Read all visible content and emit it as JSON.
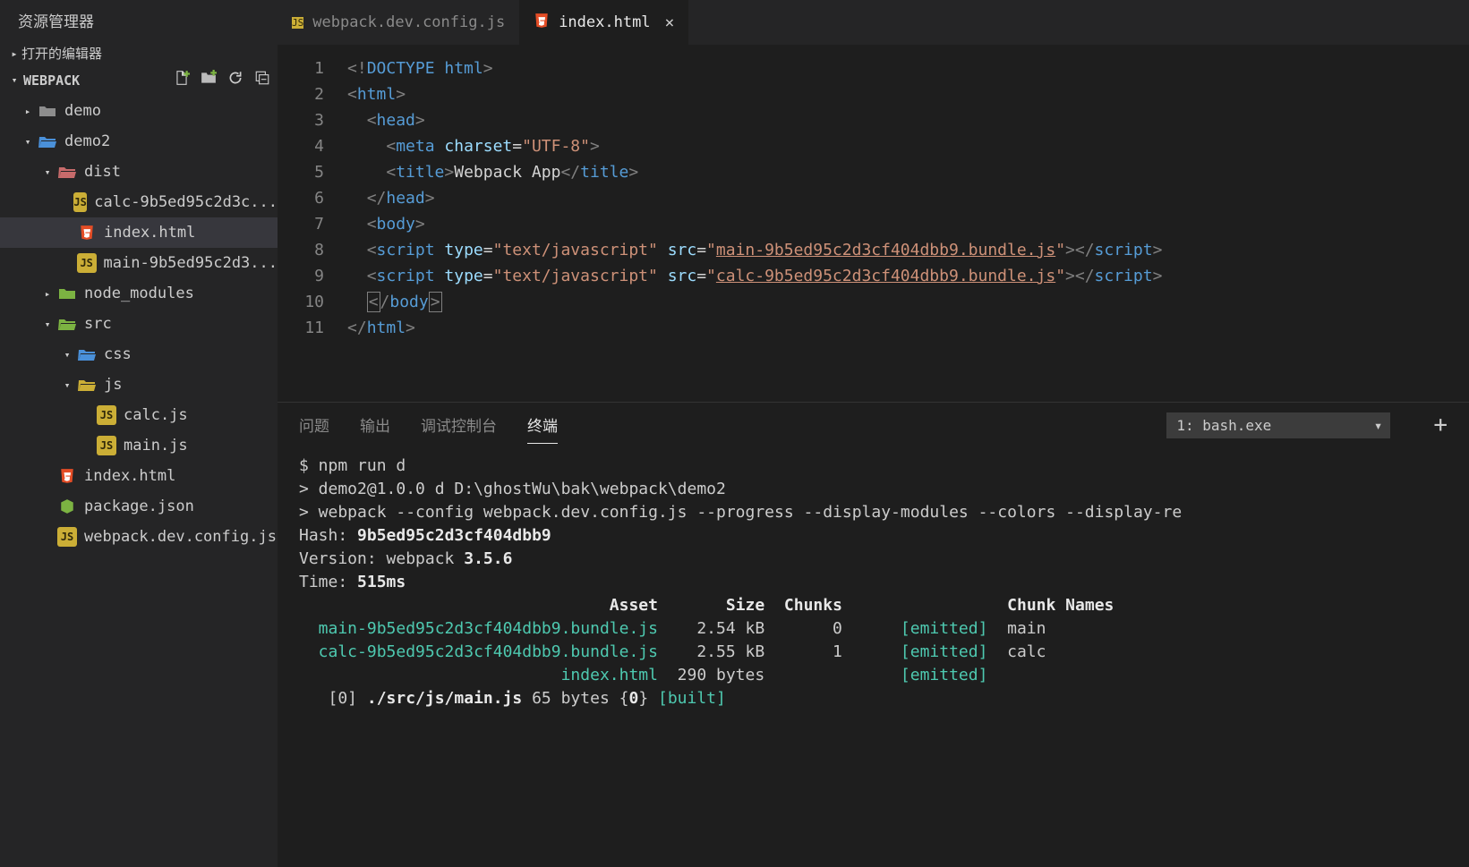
{
  "sidebar": {
    "title": "资源管理器",
    "sections": {
      "openEditors": "打开的编辑器",
      "workspace": "WEBPACK"
    },
    "tree": [
      {
        "depth": 0,
        "chev": "▸",
        "iconType": "folder",
        "iconClass": "ic-folder-g",
        "label": "demo"
      },
      {
        "depth": 0,
        "chev": "▾",
        "iconType": "folder",
        "iconClass": "ic-folder-o",
        "label": "demo2"
      },
      {
        "depth": 1,
        "chev": "▾",
        "iconType": "folder",
        "iconClass": "ic-folder-r",
        "label": "dist"
      },
      {
        "depth": 2,
        "chev": "",
        "iconType": "js",
        "label": "calc-9b5ed95c2d3c..."
      },
      {
        "depth": 2,
        "chev": "",
        "iconType": "html",
        "label": "index.html",
        "active": true
      },
      {
        "depth": 2,
        "chev": "",
        "iconType": "js",
        "label": "main-9b5ed95c2d3..."
      },
      {
        "depth": 1,
        "chev": "▸",
        "iconType": "folder",
        "iconClass": "ic-folder-gr",
        "label": "node_modules"
      },
      {
        "depth": 1,
        "chev": "▾",
        "iconType": "folder",
        "iconClass": "ic-folder-gr",
        "label": "src"
      },
      {
        "depth": 2,
        "chev": "▾",
        "iconType": "folder",
        "iconClass": "ic-folder-o",
        "label": "css"
      },
      {
        "depth": 2,
        "chev": "▾",
        "iconType": "folder",
        "iconClass": "ic-folder-y",
        "label": "js"
      },
      {
        "depth": 3,
        "chev": "",
        "iconType": "js",
        "label": "calc.js"
      },
      {
        "depth": 3,
        "chev": "",
        "iconType": "js",
        "label": "main.js"
      },
      {
        "depth": 1,
        "chev": "",
        "iconType": "html",
        "label": "index.html"
      },
      {
        "depth": 1,
        "chev": "",
        "iconType": "json",
        "label": "package.json"
      },
      {
        "depth": 1,
        "chev": "",
        "iconType": "js",
        "label": "webpack.dev.config.js"
      }
    ]
  },
  "tabs": [
    {
      "iconType": "js",
      "label": "webpack.dev.config.js",
      "active": false
    },
    {
      "iconType": "html",
      "label": "index.html",
      "active": true,
      "closable": true
    }
  ],
  "code": {
    "lines": [
      "1",
      "2",
      "3",
      "4",
      "5",
      "6",
      "7",
      "8",
      "9",
      "10",
      "11"
    ],
    "tokens": [
      [
        {
          "c": "t-bracket",
          "t": "<!"
        },
        {
          "c": "t-doctype",
          "t": "DOCTYPE html"
        },
        {
          "c": "t-bracket",
          "t": ">"
        }
      ],
      [
        {
          "c": "t-bracket",
          "t": "<"
        },
        {
          "c": "t-tag",
          "t": "html"
        },
        {
          "c": "t-bracket",
          "t": ">"
        }
      ],
      [
        {
          "sp": 2
        },
        {
          "c": "t-bracket",
          "t": "<"
        },
        {
          "c": "t-tag",
          "t": "head"
        },
        {
          "c": "t-bracket",
          "t": ">"
        }
      ],
      [
        {
          "sp": 4
        },
        {
          "c": "t-bracket",
          "t": "<"
        },
        {
          "c": "t-tag",
          "t": "meta"
        },
        {
          "t": " "
        },
        {
          "c": "t-attr",
          "t": "charset"
        },
        {
          "c": "t-eq",
          "t": "="
        },
        {
          "c": "t-str",
          "t": "\"UTF-8\""
        },
        {
          "c": "t-bracket",
          "t": ">"
        }
      ],
      [
        {
          "sp": 4
        },
        {
          "c": "t-bracket",
          "t": "<"
        },
        {
          "c": "t-tag",
          "t": "title"
        },
        {
          "c": "t-bracket",
          "t": ">"
        },
        {
          "c": "t-txt",
          "t": "Webpack App"
        },
        {
          "c": "t-bracket",
          "t": "</"
        },
        {
          "c": "t-tag",
          "t": "title"
        },
        {
          "c": "t-bracket",
          "t": ">"
        }
      ],
      [
        {
          "sp": 2
        },
        {
          "c": "t-bracket",
          "t": "</"
        },
        {
          "c": "t-tag",
          "t": "head"
        },
        {
          "c": "t-bracket",
          "t": ">"
        }
      ],
      [
        {
          "sp": 2
        },
        {
          "c": "t-bracket",
          "t": "<"
        },
        {
          "c": "t-tag",
          "t": "body"
        },
        {
          "c": "t-bracket",
          "t": ">"
        }
      ],
      [
        {
          "sp": 2
        },
        {
          "c": "t-bracket",
          "t": "<"
        },
        {
          "c": "t-tag",
          "t": "script"
        },
        {
          "t": " "
        },
        {
          "c": "t-attr",
          "t": "type"
        },
        {
          "c": "t-eq",
          "t": "="
        },
        {
          "c": "t-str",
          "t": "\"text/javascript\""
        },
        {
          "t": " "
        },
        {
          "c": "t-attr",
          "t": "src"
        },
        {
          "c": "t-eq",
          "t": "="
        },
        {
          "c": "t-str",
          "t": "\""
        },
        {
          "c": "t-link",
          "t": "main-9b5ed95c2d3cf404dbb9.bundle.js"
        },
        {
          "c": "t-str",
          "t": "\""
        },
        {
          "c": "t-bracket",
          "t": "></"
        },
        {
          "c": "t-tag",
          "t": "script"
        },
        {
          "c": "t-bracket",
          "t": ">"
        }
      ],
      [
        {
          "sp": 2
        },
        {
          "c": "t-bracket",
          "t": "<"
        },
        {
          "c": "t-tag",
          "t": "script"
        },
        {
          "t": " "
        },
        {
          "c": "t-attr",
          "t": "type"
        },
        {
          "c": "t-eq",
          "t": "="
        },
        {
          "c": "t-str",
          "t": "\"text/javascript\""
        },
        {
          "t": " "
        },
        {
          "c": "t-attr",
          "t": "src"
        },
        {
          "c": "t-eq",
          "t": "="
        },
        {
          "c": "t-str",
          "t": "\""
        },
        {
          "c": "t-link",
          "t": "calc-9b5ed95c2d3cf404dbb9.bundle.js"
        },
        {
          "c": "t-str",
          "t": "\""
        },
        {
          "c": "t-bracket",
          "t": "></"
        },
        {
          "c": "t-tag",
          "t": "script"
        },
        {
          "c": "t-bracket",
          "t": ">"
        }
      ],
      [
        {
          "sp": 2
        },
        {
          "box": true,
          "c": "t-bracket",
          "t": "<"
        },
        {
          "c": "t-bracket",
          "t": "/"
        },
        {
          "c": "t-tag",
          "t": "body"
        },
        {
          "box": true,
          "c": "t-bracket",
          "t": ">"
        }
      ],
      [
        {
          "c": "t-bracket",
          "t": "</"
        },
        {
          "c": "t-tag",
          "t": "html"
        },
        {
          "c": "t-bracket",
          "t": ">"
        }
      ]
    ]
  },
  "panel": {
    "tabs": [
      "问题",
      "输出",
      "调试控制台",
      "终端"
    ],
    "activeTab": 3,
    "select": "1: bash.exe",
    "terminal": [
      {
        "t": "$ npm run d"
      },
      {
        "t": ""
      },
      {
        "t": "> demo2@1.0.0 d D:\\ghostWu\\bak\\webpack\\demo2"
      },
      {
        "t": "> webpack --config webpack.dev.config.js --progress --display-modules --colors --display-re"
      },
      {
        "t": ""
      },
      {
        "segs": [
          {
            "t": "Hash: "
          },
          {
            "c": "tm-bold",
            "t": "9b5ed95c2d3cf404dbb9"
          }
        ]
      },
      {
        "segs": [
          {
            "t": "Version: webpack "
          },
          {
            "c": "tm-bold",
            "t": "3.5.6"
          }
        ]
      },
      {
        "segs": [
          {
            "t": "Time: "
          },
          {
            "c": "tm-bold",
            "t": "515ms"
          }
        ]
      },
      {
        "cols": [
          "Asset",
          "Size",
          "Chunks",
          "",
          "Chunk Names"
        ],
        "head": true
      },
      {
        "cols": [
          "main-9b5ed95c2d3cf404dbb9.bundle.js",
          "2.54 kB",
          "0",
          "[emitted]",
          "main"
        ],
        "asset": true
      },
      {
        "cols": [
          "calc-9b5ed95c2d3cf404dbb9.bundle.js",
          "2.55 kB",
          "1",
          "[emitted]",
          "calc"
        ],
        "asset": true
      },
      {
        "cols": [
          "index.html",
          "290 bytes",
          "",
          "[emitted]",
          ""
        ],
        "asset": true
      },
      {
        "segs": [
          {
            "t": "   [0] "
          },
          {
            "c": "tm-bold",
            "t": "./src/js/main.js"
          },
          {
            "t": " 65 bytes "
          },
          {
            "t": "{"
          },
          {
            "c": "tm-bold",
            "t": "0"
          },
          {
            "t": "} "
          },
          {
            "c": "tm-green",
            "t": "[built]"
          }
        ]
      }
    ]
  }
}
